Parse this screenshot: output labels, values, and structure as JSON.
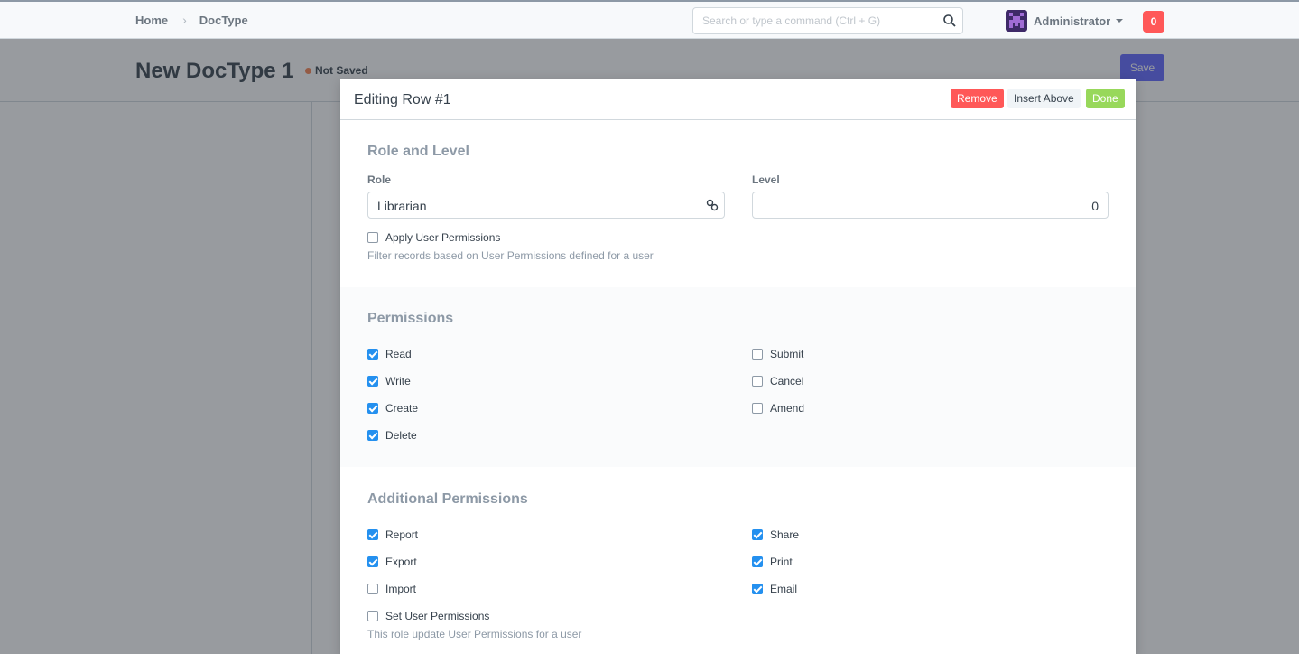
{
  "nav": {
    "breadcrumbs": [
      "Home",
      "DocType"
    ],
    "search_placeholder": "Search or type a command (Ctrl + G)",
    "user_name": "Administrator",
    "notification_count": "0"
  },
  "page": {
    "title": "New DocType 1",
    "status": "Not Saved",
    "save_label": "Save"
  },
  "modal": {
    "title": "Editing Row #1",
    "buttons": {
      "remove": "Remove",
      "insert_above": "Insert Above",
      "done": "Done"
    },
    "role_level": {
      "section_title": "Role and Level",
      "role_label": "Role",
      "role_value": "Librarian",
      "level_label": "Level",
      "level_value": "0",
      "apply_user_permissions": {
        "label": "Apply User Permissions",
        "checked": false
      },
      "apply_help": "Filter records based on User Permissions defined for a user"
    },
    "permissions": {
      "section_title": "Permissions",
      "left": [
        {
          "label": "Read",
          "checked": true
        },
        {
          "label": "Write",
          "checked": true
        },
        {
          "label": "Create",
          "checked": true
        },
        {
          "label": "Delete",
          "checked": true
        }
      ],
      "right": [
        {
          "label": "Submit",
          "checked": false
        },
        {
          "label": "Cancel",
          "checked": false
        },
        {
          "label": "Amend",
          "checked": false
        }
      ]
    },
    "additional": {
      "section_title": "Additional Permissions",
      "left": [
        {
          "label": "Report",
          "checked": true
        },
        {
          "label": "Export",
          "checked": true
        },
        {
          "label": "Import",
          "checked": false
        },
        {
          "label": "Set User Permissions",
          "checked": false
        }
      ],
      "right": [
        {
          "label": "Share",
          "checked": true
        },
        {
          "label": "Print",
          "checked": true
        },
        {
          "label": "Email",
          "checked": true
        }
      ],
      "set_user_help": "This role update User Permissions for a user"
    }
  },
  "colors": {
    "primary": "#5e64ff",
    "danger": "#ff5858",
    "success": "#98d85b",
    "checkbox": "#2490ef"
  }
}
